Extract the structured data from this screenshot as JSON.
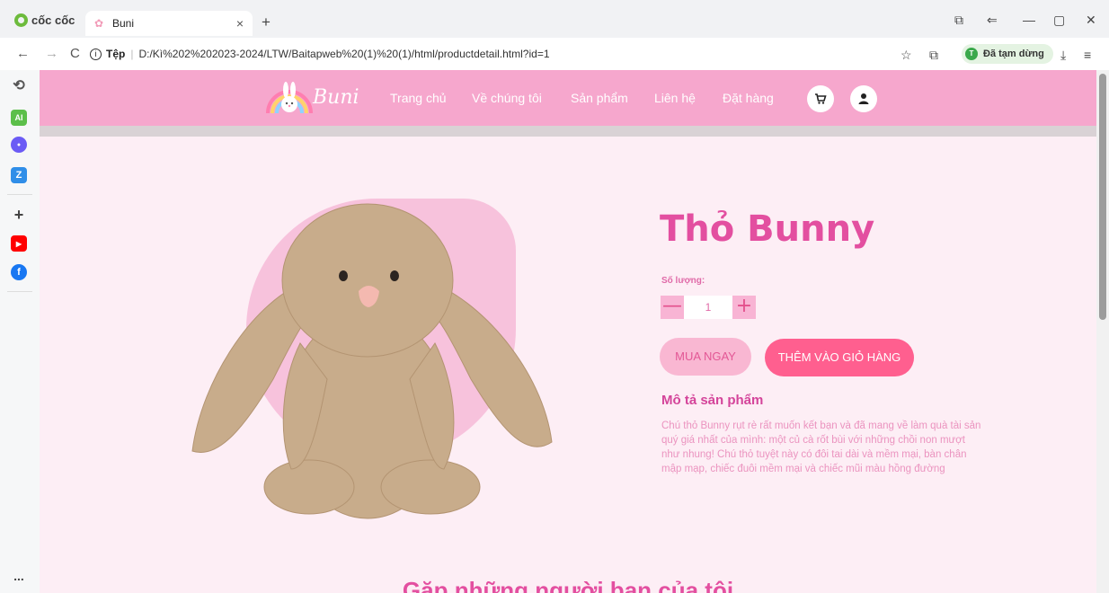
{
  "browser": {
    "brand": "cốc cốc",
    "tab": {
      "title": "Buni",
      "close": "×"
    },
    "new_tab": "+",
    "window": {
      "restore": "⧉",
      "minimize": "—",
      "maximize": "▢",
      "close": "✕"
    },
    "nav": {
      "back": "←",
      "forward": "→",
      "reload": "C"
    },
    "address": {
      "protocol": "Tệp",
      "url": "D:/Kì%202%202023-2024/LTW/Baitapweb%20(1)%20(1)/html/productdetail.html?id=1"
    },
    "profile": {
      "initial": "T",
      "label": "Đã tạm dừng"
    },
    "toolbar_icons": {
      "star": "☆",
      "extensions": "⧉",
      "download": "⤓",
      "menu": "≡"
    }
  },
  "sidebar": {
    "items": [
      {
        "icon": "history-icon",
        "glyph": "⟲",
        "color": "#555555"
      },
      {
        "icon": "ai-icon",
        "glyph": "AI",
        "color": "#5cbf4a"
      },
      {
        "icon": "messenger-icon",
        "glyph": "●",
        "color": "#6b5bf5"
      },
      {
        "icon": "zalo-icon",
        "glyph": "Z",
        "color": "#2f8ee8"
      },
      {
        "icon": "add-icon",
        "glyph": "+",
        "color": "#444444"
      },
      {
        "icon": "youtube-icon",
        "glyph": "▶",
        "color": "#ff0000"
      },
      {
        "icon": "facebook-icon",
        "glyph": "f",
        "color": "#1877f2"
      }
    ],
    "more": "..."
  },
  "site": {
    "logo": "Buni",
    "nav": [
      "Trang chủ",
      "Về chúng tôi",
      "Sản phẩm",
      "Liên hệ",
      "Đặt hàng"
    ],
    "colors": {
      "header": "#f6a7cd",
      "page": "#fdeef5",
      "accent": "#e34fa0",
      "cart_button": "#ff5f8f"
    }
  },
  "product": {
    "title": "Thỏ Bunny",
    "quantity_label": "Số lượng:",
    "quantity": "1",
    "minus": "—",
    "plus": "+",
    "buy_now": "MUA NGAY",
    "add_to_cart": "THÊM VÀO GIỎ HÀNG",
    "description_title": "Mô tả sản phẩm",
    "description": "Chú thỏ Bunny rụt rè rất muốn kết bạn và đã mang về làm quà tài sản quý giá nhất của mình: một củ cà rốt bùi với những chồi non mượt như nhung! Chú thỏ tuyệt này có đôi tai dài và mềm mại, bàn chân mập mạp, chiếc đuôi mềm mại và chiếc mũi màu hồng đường"
  },
  "section": {
    "friends_title": "Gặp những người bạn của tôi"
  }
}
